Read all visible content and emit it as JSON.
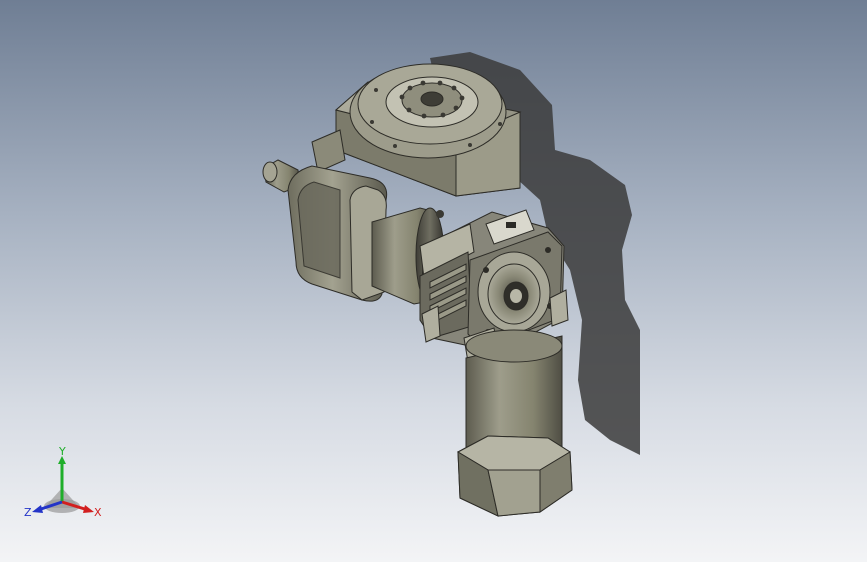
{
  "viewport": {
    "background_top": "#6f7e94",
    "background_bottom": "#f3f4f6",
    "model_color": "#8f8e7c",
    "shadow_color": "#3a3a3a"
  },
  "triad": {
    "x_label": "X",
    "y_label": "Y",
    "z_label": "Z",
    "x_color": "#d21f1f",
    "y_color": "#1fae2a",
    "z_color": "#2334c8"
  }
}
